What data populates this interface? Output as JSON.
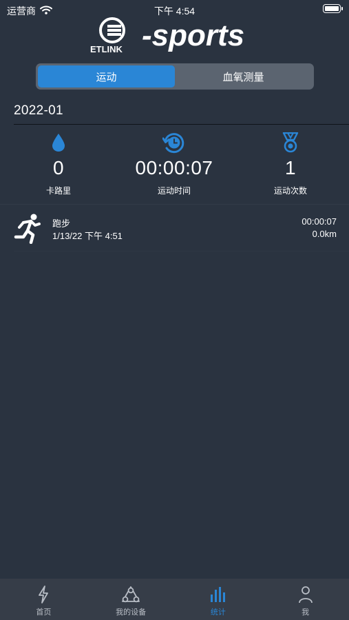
{
  "status_bar": {
    "carrier": "运营商",
    "time": "下午 4:54"
  },
  "logo": {
    "brand": "ETLINK",
    "product": "-sports"
  },
  "segments": [
    {
      "label": "运动",
      "active": true
    },
    {
      "label": "血氧测量",
      "active": false
    }
  ],
  "month": "2022-01",
  "stats": {
    "calories": {
      "value": "0",
      "label": "卡路里",
      "icon": "water-drop-icon"
    },
    "duration": {
      "value": "00:00:07",
      "label": "运动时间",
      "icon": "clock-refresh-icon"
    },
    "count": {
      "value": "1",
      "label": "运动次数",
      "icon": "medal-icon"
    }
  },
  "records": [
    {
      "type": "跑步",
      "datetime": "1/13/22 下午 4:51",
      "duration": "00:00:07",
      "distance": "0.0km",
      "icon": "running-icon"
    }
  ],
  "tabbar": [
    {
      "label": "首页",
      "icon": "lightning-icon",
      "active": false
    },
    {
      "label": "我的设备",
      "icon": "devices-icon",
      "active": false
    },
    {
      "label": "统计",
      "icon": "bar-chart-icon",
      "active": true
    },
    {
      "label": "我",
      "icon": "person-icon",
      "active": false
    }
  ],
  "colors": {
    "background": "#2a3340",
    "accent": "#2a86d6",
    "tabbar": "#363d48",
    "segment_bg": "#5b6470"
  }
}
